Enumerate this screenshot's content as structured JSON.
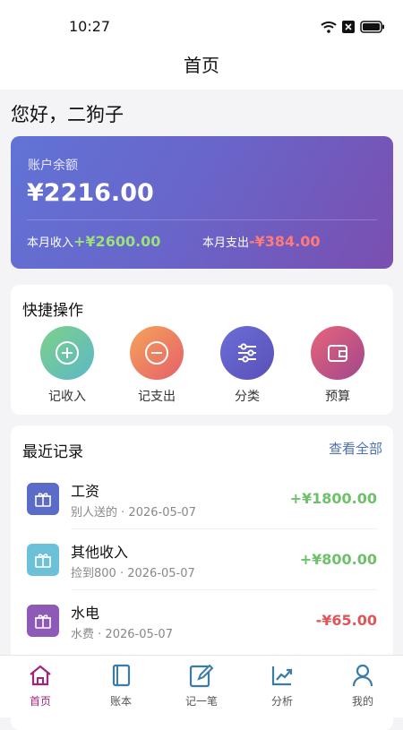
{
  "status_bar": {
    "time": "10:27"
  },
  "header": {
    "title": "首页"
  },
  "greeting": "您好，二狗子",
  "balance": {
    "label": "账户余额",
    "amount": "¥2216.00",
    "income_label": "本月收入",
    "income_value": "+¥2600.00",
    "expense_label": "本月支出",
    "expense_value": "-¥384.00"
  },
  "quick_actions": {
    "title": "快捷操作",
    "items": [
      {
        "label": "记收入",
        "icon": "plus-circle-icon"
      },
      {
        "label": "记支出",
        "icon": "minus-circle-icon"
      },
      {
        "label": "分类",
        "icon": "sliders-icon"
      },
      {
        "label": "预算",
        "icon": "wallet-icon"
      }
    ]
  },
  "recent": {
    "title": "最近记录",
    "view_all": "查看全部",
    "records": [
      {
        "name": "工资",
        "note": "别人送的",
        "date": "2026-05-07",
        "amount": "+¥1800.00"
      },
      {
        "name": "其他收入",
        "note": "捡到800",
        "date": "2026-05-07",
        "amount": "+¥800.00"
      },
      {
        "name": "水电",
        "note": "水费",
        "date": "2026-05-07",
        "amount": "-¥65.00"
      }
    ]
  },
  "tab_bar": {
    "items": [
      {
        "label": "首页",
        "icon": "home-icon"
      },
      {
        "label": "账本",
        "icon": "book-icon"
      },
      {
        "label": "记一笔",
        "icon": "edit-icon"
      },
      {
        "label": "分析",
        "icon": "chart-icon"
      },
      {
        "label": "我的",
        "icon": "user-icon"
      }
    ]
  },
  "colors": {
    "accent": "#a0257e",
    "income": "#6fc06b",
    "expense": "#e0555a",
    "link": "#4d6fb3"
  }
}
